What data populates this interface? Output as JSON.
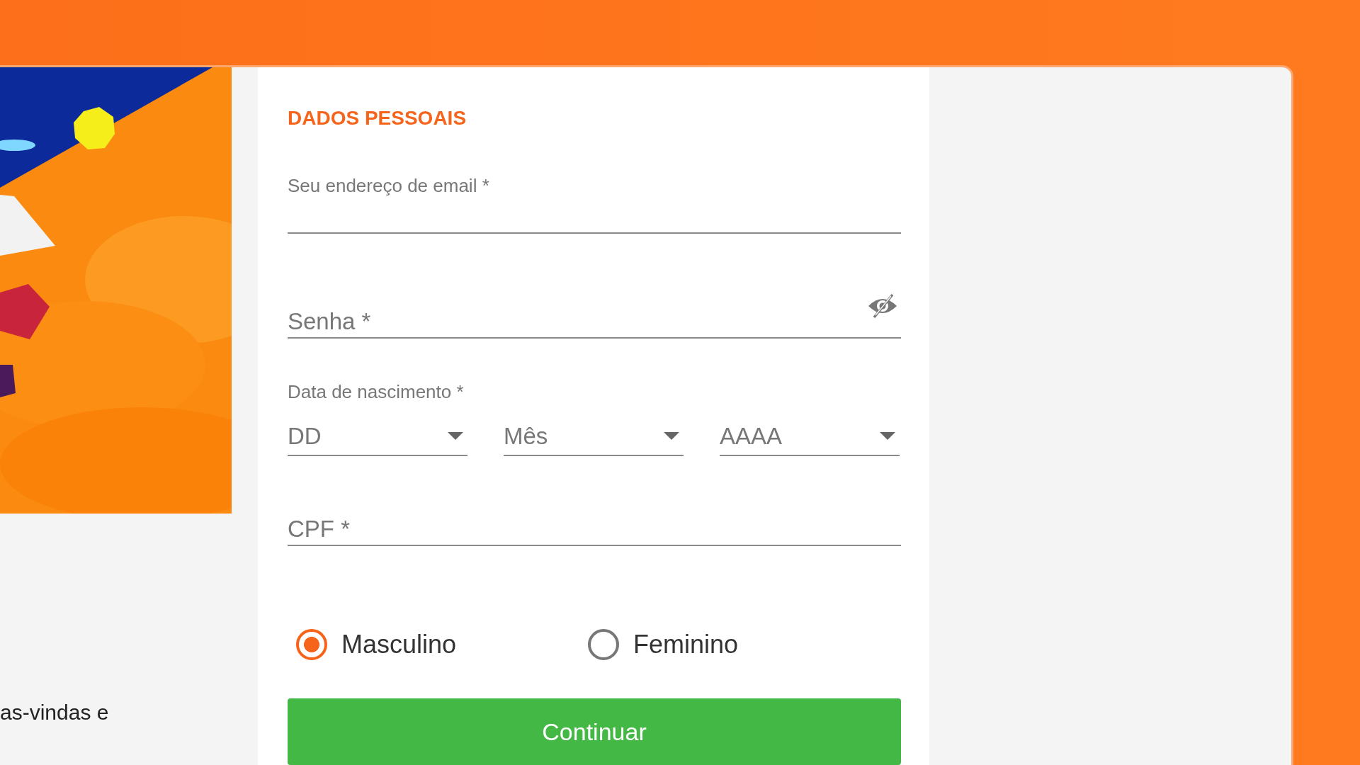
{
  "welcome_text": "as-vindas e",
  "form": {
    "title": "DADOS PESSOAIS",
    "email": {
      "label": "Seu endereço de email *"
    },
    "password": {
      "placeholder": "Senha *"
    },
    "birth_date": {
      "label": "Data de nascimento *",
      "selects": [
        {
          "placeholder": "DD"
        },
        {
          "placeholder": "Mês"
        },
        {
          "placeholder": "AAAA"
        }
      ]
    },
    "cpf": {
      "placeholder": "CPF *"
    },
    "gender": [
      {
        "label": "Masculino",
        "selected": true
      },
      {
        "label": "Feminino",
        "selected": false
      }
    ],
    "submit": {
      "label": "Continuar"
    }
  }
}
